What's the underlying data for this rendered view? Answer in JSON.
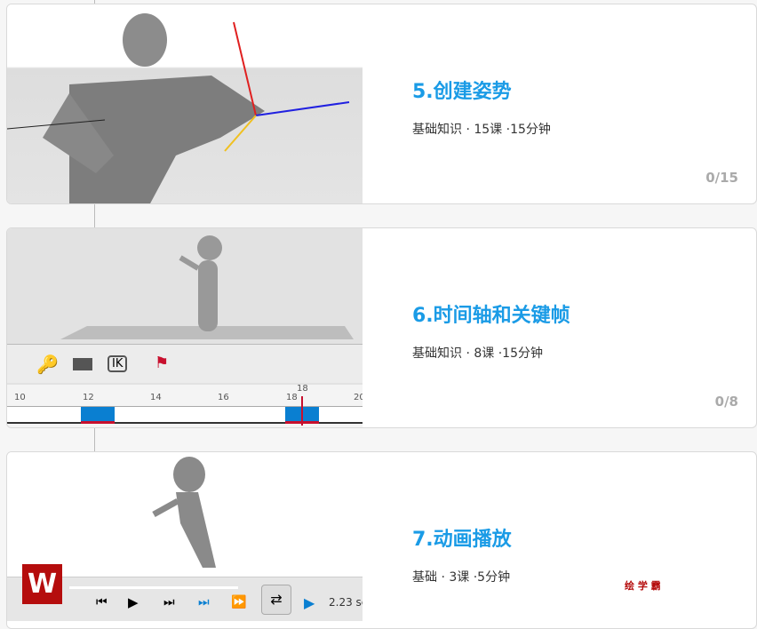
{
  "cards": [
    {
      "title": "5.创建姿势",
      "meta": "基础知识 · 15课 ·15分钟",
      "progress": "0/15"
    },
    {
      "title": "6.时间轴和关键帧",
      "meta": "基础知识 · 8课 ·15分钟",
      "progress": "0/8",
      "timeline_ticks": [
        "10",
        "12",
        "14",
        "16",
        "18",
        "20"
      ],
      "current_frame": "18"
    },
    {
      "title": "7.动画播放",
      "meta": "基础 · 3课 ·5分钟",
      "playback_time": "2.23 se"
    }
  ],
  "watermark": "绘 学 霸",
  "colors": {
    "accent": "#1a9be6",
    "key": "#0a7fd1",
    "marker": "#c8102e"
  }
}
